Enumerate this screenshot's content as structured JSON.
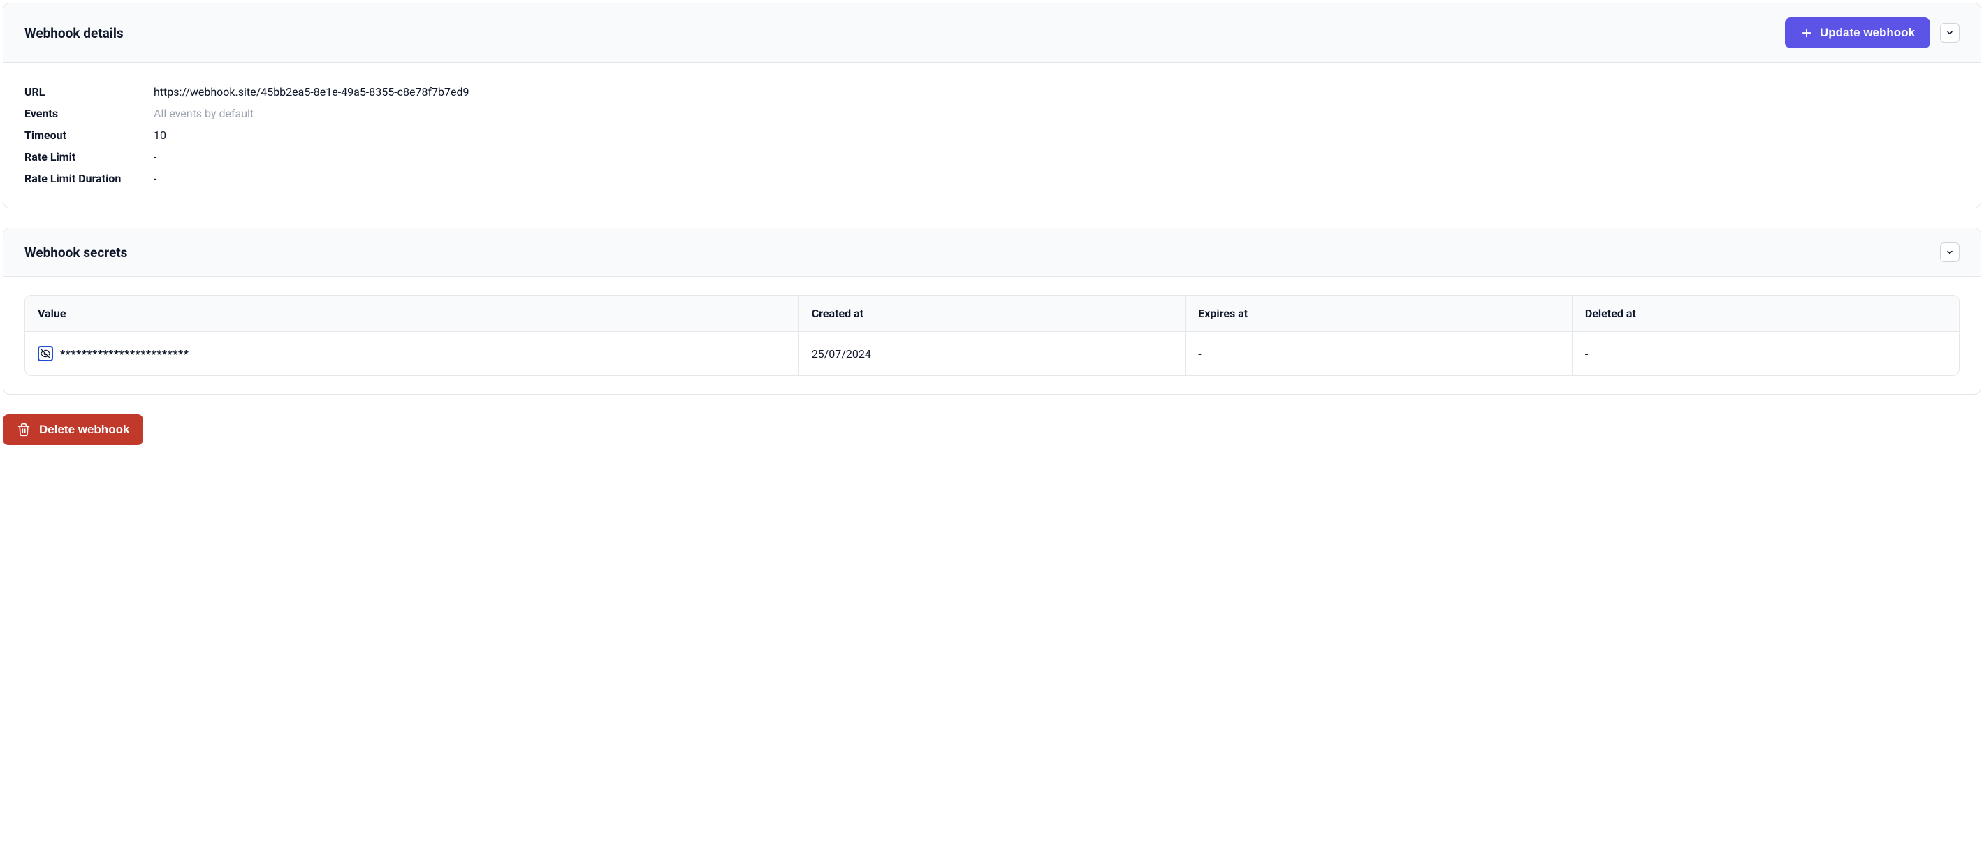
{
  "details_card": {
    "title": "Webhook details",
    "update_label": "Update webhook",
    "rows": {
      "url": {
        "label": "URL",
        "value": "https://webhook.site/45bb2ea5-8e1e-49a5-8355-c8e78f7b7ed9"
      },
      "events": {
        "label": "Events",
        "value": "All events by default"
      },
      "timeout": {
        "label": "Timeout",
        "value": "10"
      },
      "rate_limit": {
        "label": "Rate Limit",
        "value": "-"
      },
      "rate_limit_duration": {
        "label": "Rate Limit Duration",
        "value": "-"
      }
    }
  },
  "secrets_card": {
    "title": "Webhook secrets",
    "columns": {
      "value": "Value",
      "created_at": "Created at",
      "expires_at": "Expires at",
      "deleted_at": "Deleted at"
    },
    "rows": [
      {
        "value_mask": "************************",
        "created_at": "25/07/2024",
        "expires_at": "-",
        "deleted_at": "-"
      }
    ]
  },
  "delete_button_label": "Delete webhook"
}
